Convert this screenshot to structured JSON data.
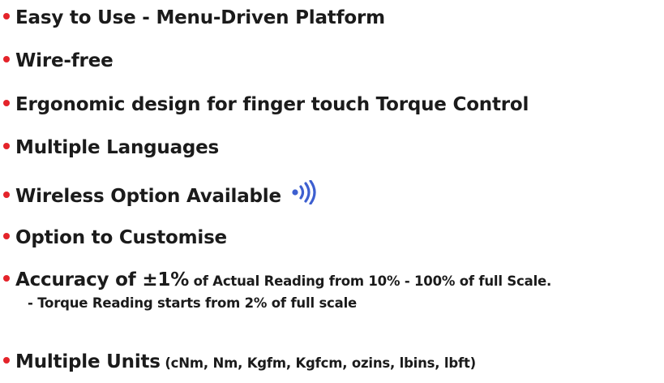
{
  "items": [
    {
      "text": "Easy to Use - Menu-Driven Platform"
    },
    {
      "text": "Wire-free"
    },
    {
      "text": "Ergonomic design for finger touch Torque Control"
    },
    {
      "text": "Multiple Languages"
    },
    {
      "text": "Wireless Option Available",
      "icon": "wireless-signal-icon"
    },
    {
      "text": "Option to Customise"
    },
    {
      "main": "Accuracy of ±1%",
      "detail": " of Actual Reading from 10% - 100% of full Scale.",
      "sub": "- Torque Reading starts from 2% of full scale"
    },
    {
      "main": "Multiple Units",
      "detail": " (cNm, Nm, Kgfm, Kgfcm, ozins, lbins, lbft)"
    }
  ],
  "colors": {
    "bullet": "#e4232a",
    "text": "#1b1b1b",
    "wireless_icon": "#3d5fd0"
  }
}
